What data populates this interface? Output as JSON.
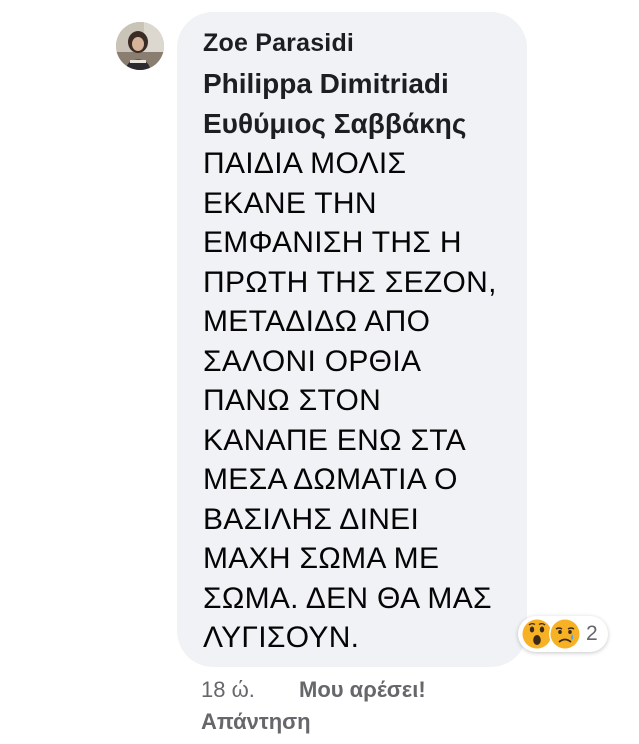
{
  "comment": {
    "author": "Zoe Parasidi",
    "avatar_icon": "profile-photo",
    "tagged": [
      "Philippa Dimitriadi",
      "Ευθύμιος Σαββάκης"
    ],
    "text_lines": [
      "ΠΑΙΔΙΑ ΜΟΛΙΣ",
      "ΕΚΑΝΕ ΤΗΝ",
      "ΕΜΦΑΝΙΣΗ ΤΗΣ Η",
      "ΠΡΩΤΗ ΤΗΣ ΣΕΖΟΝ,",
      "ΜΕΤΑΔΙΔΩ ΑΠΟ",
      "ΣΑΛΟΝΙ ΟΡΘΙΑ",
      "ΠΑΝΩ ΣΤΟΝ",
      "ΚΑΝΑΠΕ ΕΝΩ ΣΤΑ",
      "ΜΕΣΑ ΔΩΜΑΤΙΑ Ο",
      "ΒΑΣΙΛΗΣ ΔΙΝΕΙ",
      "ΜΑΧΗ ΣΩΜΑ ΜΕ",
      "ΣΩΜΑ. ΔΕΝ ΘΑ ΜΑΣ",
      "ΛΥΓΙΣΟΥΝ."
    ],
    "reactions": {
      "icons": [
        "wow-icon",
        "sad-icon"
      ],
      "count": "2"
    },
    "time": "18 ώ.",
    "like_label": "Μου αρέσει!",
    "reply_label": "Απάντηση"
  },
  "colors": {
    "bubble": "#f0f2f5",
    "secondary_text": "#65676b",
    "reaction_yellow": "#f7b125"
  }
}
